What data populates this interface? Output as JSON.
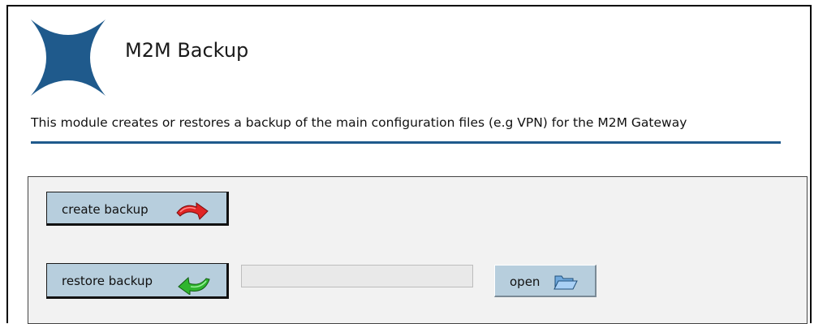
{
  "header": {
    "title": "M2M Backup",
    "logo_icon": "m2m-star-logo"
  },
  "description": "This module creates or restores a backup of the main configuration files (e.g VPN) for the M2M Gateway",
  "actions": {
    "create_label": "create backup",
    "create_icon": "red-redo-arrow-icon",
    "restore_label": "restore backup",
    "restore_icon": "green-undo-arrow-icon",
    "file_value": "",
    "open_label": "open",
    "open_icon": "folder-open-icon"
  },
  "colors": {
    "accent": "#1f5a8c",
    "button_bg": "#b7cedd",
    "panel_bg": "#f2f2f2",
    "logo": "#1f5a8c"
  }
}
